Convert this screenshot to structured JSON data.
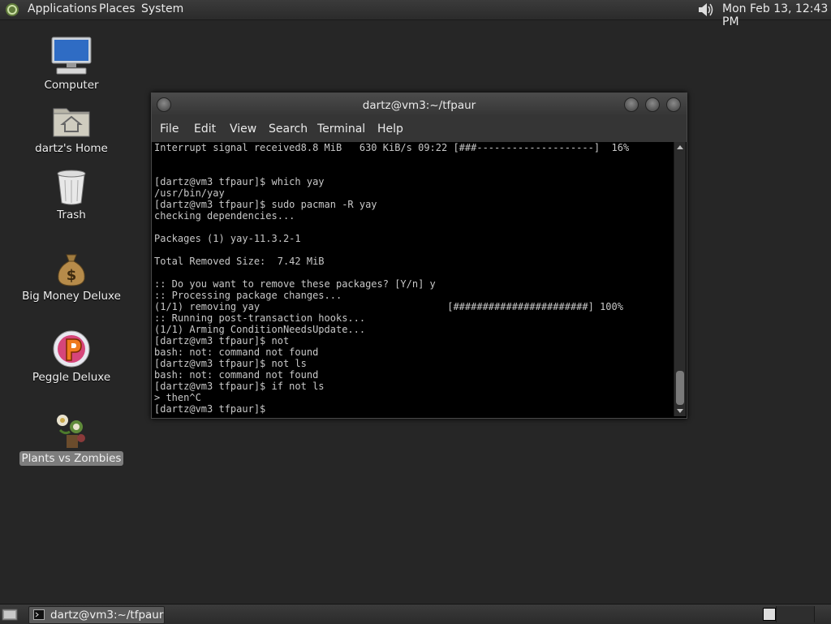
{
  "top_panel": {
    "menus": [
      "Applications",
      "Places",
      "System"
    ],
    "clock": "Mon Feb 13, 12:43 PM"
  },
  "desktop": {
    "icons": [
      {
        "label": "Computer",
        "icon": "computer-icon"
      },
      {
        "label": "dartz's Home",
        "icon": "home-folder-icon"
      },
      {
        "label": "Trash",
        "icon": "trash-icon"
      },
      {
        "label": "Big Money Deluxe",
        "icon": "money-bag-icon"
      },
      {
        "label": "Peggle Deluxe",
        "icon": "peggle-icon"
      },
      {
        "label": "Plants vs Zombies",
        "icon": "plants-vs-zombies-icon",
        "selected": true
      }
    ]
  },
  "terminal": {
    "title": "dartz@vm3:~/tfpaur",
    "menu": [
      "File",
      "Edit",
      "View",
      "Search",
      "Terminal",
      "Help"
    ],
    "lines": [
      "Interrupt signal received8.8 MiB   630 KiB/s 09:22 [###--------------------]  16%",
      "",
      "",
      "[dartz@vm3 tfpaur]$ which yay",
      "/usr/bin/yay",
      "[dartz@vm3 tfpaur]$ sudo pacman -R yay",
      "checking dependencies...",
      "",
      "Packages (1) yay-11.3.2-1",
      "",
      "Total Removed Size:  7.42 MiB",
      "",
      ":: Do you want to remove these packages? [Y/n] y",
      ":: Processing package changes...",
      "(1/1) removing yay                                [#######################] 100%",
      ":: Running post-transaction hooks...",
      "(1/1) Arming ConditionNeedsUpdate...",
      "[dartz@vm3 tfpaur]$ not",
      "bash: not: command not found",
      "[dartz@vm3 tfpaur]$ not ls",
      "bash: not: command not found",
      "[dartz@vm3 tfpaur]$ if not ls",
      "> then^C",
      "[dartz@vm3 tfpaur]$ "
    ]
  },
  "taskbar": {
    "tasks": [
      {
        "label": "dartz@vm3:~/tfpaur",
        "icon": "terminal-icon"
      }
    ]
  }
}
